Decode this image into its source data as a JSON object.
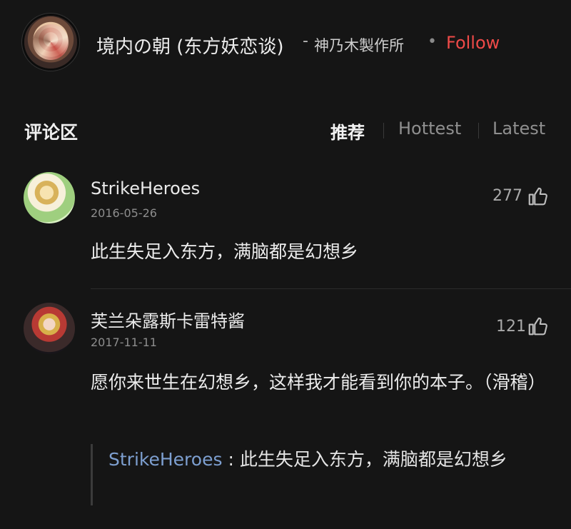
{
  "header": {
    "title": "境内の朝 (东方妖恋谈)",
    "separator": "-",
    "studio": "神乃木製作所",
    "dot": "•",
    "follow_label": "Follow"
  },
  "comments_section": {
    "label": "评论区",
    "tabs": [
      "推荐",
      "Hottest",
      "Latest"
    ]
  },
  "comments": [
    {
      "user": "StrikeHeroes",
      "date": "2016-05-26",
      "likes": "277",
      "text": "此生失足入东方，满脑都是幻想乡"
    },
    {
      "user": "芙兰朵露斯卡雷特酱",
      "date": "2017-11-11",
      "likes": "121",
      "text": "愿你来世生在幻想乡，这样我才能看到你的本子。（滑稽）",
      "reply": {
        "user": "StrikeHeroes",
        "separator": ":",
        "text": "此生失足入东方，满脑都是幻想乡"
      }
    }
  ],
  "icons": {
    "like": "thumbs-up-icon"
  },
  "colors": {
    "background": "#151515",
    "accent_follow": "#ef4a48",
    "reply_user": "#7d9fd0"
  }
}
